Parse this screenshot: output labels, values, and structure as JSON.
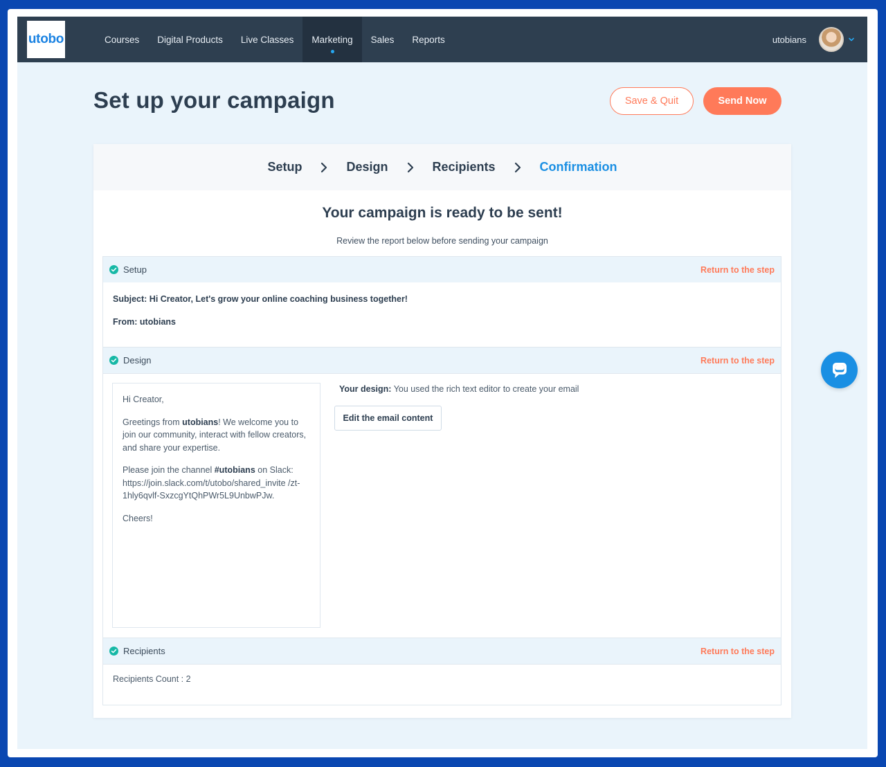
{
  "nav": {
    "logo": "utobo",
    "items": [
      {
        "label": "Courses"
      },
      {
        "label": "Digital Products"
      },
      {
        "label": "Live Classes"
      },
      {
        "label": "Marketing"
      },
      {
        "label": "Sales"
      },
      {
        "label": "Reports"
      }
    ],
    "active": "Marketing",
    "username": "utobians"
  },
  "page": {
    "title": "Set up your campaign",
    "save_quit": "Save & Quit",
    "send_now": "Send Now"
  },
  "steps": {
    "items": [
      "Setup",
      "Design",
      "Recipients",
      "Confirmation"
    ],
    "current": "Confirmation"
  },
  "summary": {
    "heading": "Your campaign is ready to be sent!",
    "subheading": "Review the report below before sending your campaign",
    "return_label": "Return to the step"
  },
  "setup": {
    "label": "Setup",
    "subject_label": "Subject:",
    "subject": "Hi Creator, Let's grow your online coaching business together!",
    "from_label": "From:",
    "from": "utobians"
  },
  "design": {
    "label": "Design",
    "info_label": "Your design:",
    "info": "You used the rich text editor to create your email",
    "edit_button": "Edit the email content",
    "preview": {
      "greeting": "Hi Creator,",
      "p1_before": "Greetings from ",
      "p1_bold": "utobians",
      "p1_after": "! We welcome you to join our community, interact with fellow creators, and share your expertise.",
      "p2_before": "Please join the channel ",
      "p2_bold": "#utobians",
      "p2_after": " on Slack: https://join.slack.com/t/utobo/shared_invite /zt-1hly6qvlf-SxzcgYtQhPWr5L9UnbwPJw.",
      "closing": "Cheers!"
    }
  },
  "recipients": {
    "label": "Recipients",
    "count_text": "Recipients Count : 2"
  },
  "colors": {
    "nav_bg": "#2e3f50",
    "accent_orange": "#ff7a59",
    "accent_blue": "#1a8fe3",
    "check_green": "#17b8a6",
    "page_bg": "#eaf4fb",
    "outer_frame": "#0a47b1"
  },
  "icons": [
    "chevron-down-icon",
    "chevron-right-icon",
    "check-circle-icon",
    "chat-bubble-icon"
  ]
}
